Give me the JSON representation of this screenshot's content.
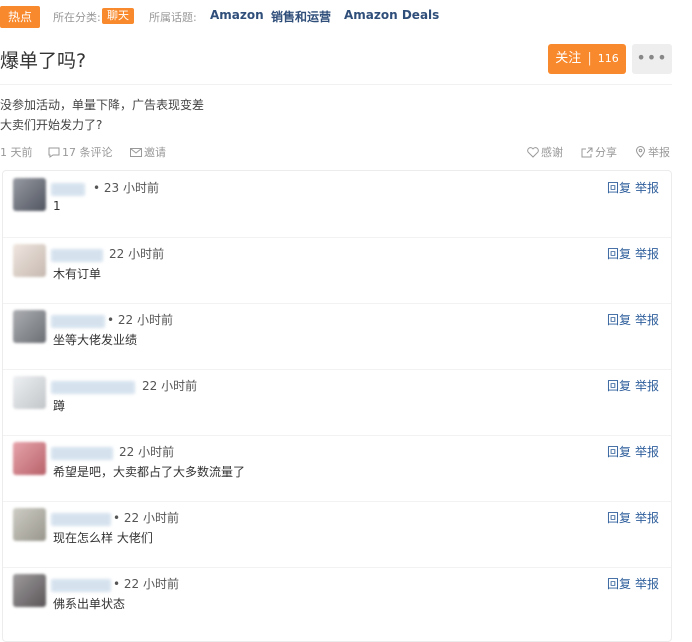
{
  "header": {
    "hot_badge": "热点",
    "category_label": "所在分类:",
    "category": "聊天",
    "topic_label": "所属话题:",
    "topics": [
      "Amazon",
      "销售和运营",
      "Amazon Deals"
    ]
  },
  "post": {
    "title": "爆单了吗?",
    "follow_label": "关注",
    "follow_separator": "|",
    "follow_count": "116",
    "more_label": "•••",
    "body_lines": [
      "没参加活动，单量下降，广告表现变差",
      "大卖们开始发力了?"
    ],
    "time": "1 天前",
    "comment_count": "17 条评论",
    "invite": "邀请",
    "thanks": "感谢",
    "share": "分享",
    "report": "举报"
  },
  "comment_actions": {
    "reply": "回复",
    "report": "举报"
  },
  "comments": [
    {
      "time": "• 23 小时前",
      "text": "1",
      "avatar_color": "#5f6470"
    },
    {
      "time": "22 小时前",
      "text": "木有订单",
      "avatar_color": "#e8d9cf"
    },
    {
      "time": "• 22 小时前",
      "text": "坐等大佬发业绩",
      "avatar_color": "#7e8288"
    },
    {
      "time": "22 小时前",
      "text": "蹲",
      "avatar_color": "#e4e8ec"
    },
    {
      "time": "22 小时前",
      "text": "希望是吧，大卖都占了大多数流量了",
      "avatar_color": "#d9737d"
    },
    {
      "time": "• 22 小时前",
      "text": "现在怎么样 大佬们",
      "avatar_color": "#b3b1a5"
    },
    {
      "time": "• 22 小时前",
      "text": "佛系出单状态",
      "avatar_color": "#6a6568"
    }
  ]
}
